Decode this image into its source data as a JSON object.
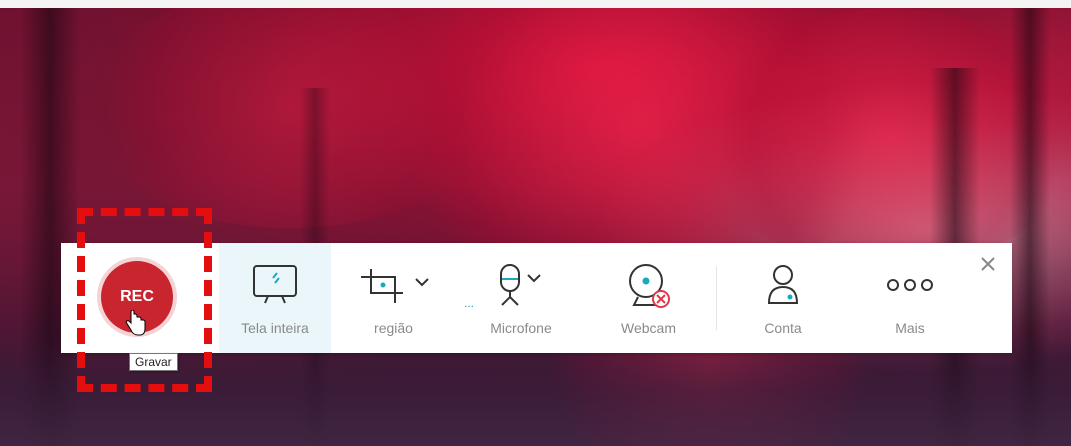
{
  "toolbar": {
    "rec_label": "REC",
    "tooltip": "Gravar",
    "items": [
      {
        "label": "Tela inteira"
      },
      {
        "label": "região"
      },
      {
        "label": "Microfone"
      },
      {
        "label": "Webcam"
      },
      {
        "label": "Conta"
      },
      {
        "label": "Mais"
      }
    ]
  },
  "colors": {
    "accent_teal": "#1aa8bf",
    "rec_red": "#c9252f",
    "highlight_red": "#e50e0e",
    "active_bg": "#eaf6fa"
  },
  "icons": [
    "monitor-icon",
    "crop-region-icon",
    "microphone-icon",
    "webcam-off-icon",
    "account-icon",
    "more-icon",
    "close-icon",
    "hand-cursor-icon"
  ]
}
